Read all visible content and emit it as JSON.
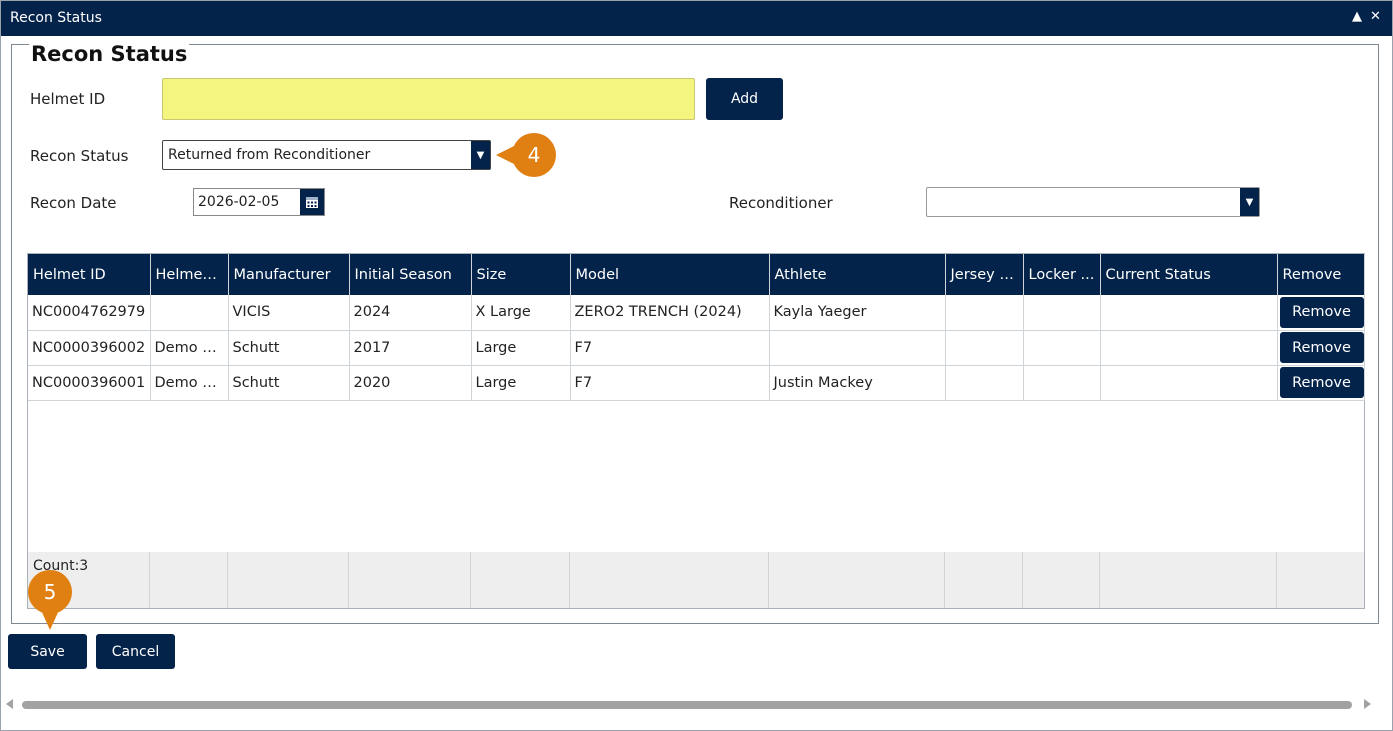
{
  "window": {
    "title": "Recon Status",
    "collapse_glyph": "▲",
    "close_glyph": "✕"
  },
  "form": {
    "legend": "Recon Status",
    "helmet_id_label": "Helmet ID",
    "helmet_id_value": "",
    "add_label": "Add",
    "recon_status_label": "Recon Status",
    "recon_status_value": "Returned from Reconditioner",
    "recon_date_label": "Recon Date",
    "recon_date_value": "2026-02-05",
    "reconditioner_label": "Reconditioner",
    "reconditioner_value": ""
  },
  "callouts": {
    "step4": "4",
    "step5": "5"
  },
  "grid": {
    "headers": [
      "Helmet ID",
      "Helmet ...",
      "Manufacturer",
      "Initial Season",
      "Size",
      "Model",
      "Athlete",
      "Jersey No",
      "Locker ...",
      "Current Status",
      "Remove"
    ],
    "rows": [
      [
        "NC0004762979",
        "",
        "VICIS",
        "2024",
        "X Large",
        "ZERO2 TRENCH (2024)",
        "Kayla Yaeger",
        "",
        "",
        ""
      ],
      [
        "NC0000396002",
        "Demo S...",
        "Schutt",
        "2017",
        "Large",
        "F7",
        "",
        "",
        "",
        ""
      ],
      [
        "NC0000396001",
        "Demo O...",
        "Schutt",
        "2020",
        "Large",
        "F7",
        "Justin Mackey",
        "",
        "",
        ""
      ]
    ],
    "remove_label": "Remove",
    "count": "Count:3"
  },
  "actions": {
    "save_label": "Save",
    "cancel_label": "Cancel"
  },
  "colors": {
    "navy": "#04234a",
    "highlight_input": "#f3f57e",
    "callout": "#e07f12"
  }
}
